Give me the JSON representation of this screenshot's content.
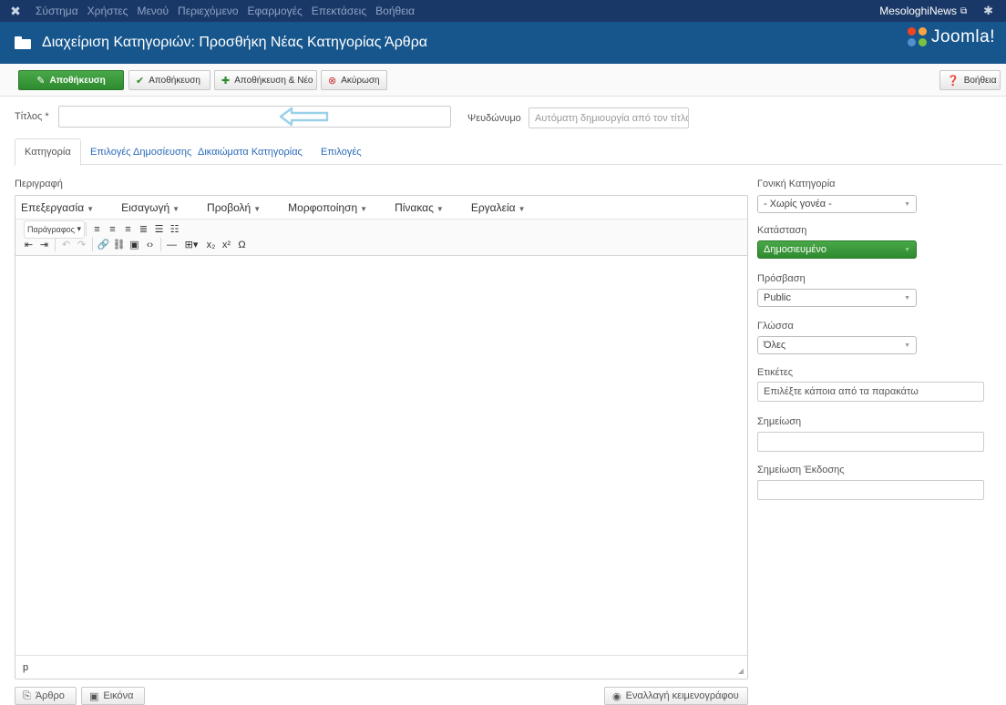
{
  "topnav": {
    "menu": [
      "Σύστημα",
      "Χρήστες",
      "Μενού",
      "Περιεχόμενο",
      "Εφαρμογές",
      "Επεκτάσεις",
      "Βοήθεια"
    ],
    "site_name": "MesologhiNews"
  },
  "header": {
    "title": "Διαχείριση Κατηγοριών: Προσθήκη Νέας Κατηγορίας Άρθρα",
    "logo_text": "Joomla!"
  },
  "toolbar": {
    "save": "Αποθήκευση",
    "save_close": "Αποθήκευση",
    "save_new": "Αποθήκευση & Νέο",
    "cancel": "Ακύρωση",
    "help": "Βοήθεια"
  },
  "form": {
    "title_label": "Τίτλος *",
    "title_value": "",
    "alias_label": "Ψευδώνυμο",
    "alias_placeholder": "Αυτόματη δημιουργία από τον τίτλο"
  },
  "tabs": [
    "Κατηγορία",
    "Επιλογές Δημοσίευσης",
    "Δικαιώματα Κατηγορίας",
    "Επιλογές"
  ],
  "editor": {
    "label": "Περιγραφή",
    "menus": [
      "Επεξεργασία",
      "Εισαγωγή",
      "Προβολή",
      "Μορφοποίηση",
      "Πίνακας",
      "Εργαλεία"
    ],
    "format_select": "Παράγραφος",
    "status_path": "p",
    "buttons": {
      "article": "Άρθρο",
      "image": "Εικόνα",
      "toggle": "Εναλλαγή κειμενογράφου"
    }
  },
  "sidebar": {
    "parent_label": "Γονική Κατηγορία",
    "parent_value": "- Χωρίς γονέα -",
    "status_label": "Κατάσταση",
    "status_value": "Δημοσιευμένο",
    "access_label": "Πρόσβαση",
    "access_value": "Public",
    "language_label": "Γλώσσα",
    "language_value": "Όλες",
    "tags_label": "Ετικέτες",
    "tags_placeholder": "Επιλέξτε κάποια από τα παρακάτω",
    "note_label": "Σημείωση",
    "version_note_label": "Σημείωση Έκδοσης"
  },
  "colors": {
    "topnav": "#1a3867",
    "header": "#17568c",
    "primary_green": "#3a9a3a",
    "link": "#2a69b8",
    "arrow": "#9ad0e8"
  }
}
